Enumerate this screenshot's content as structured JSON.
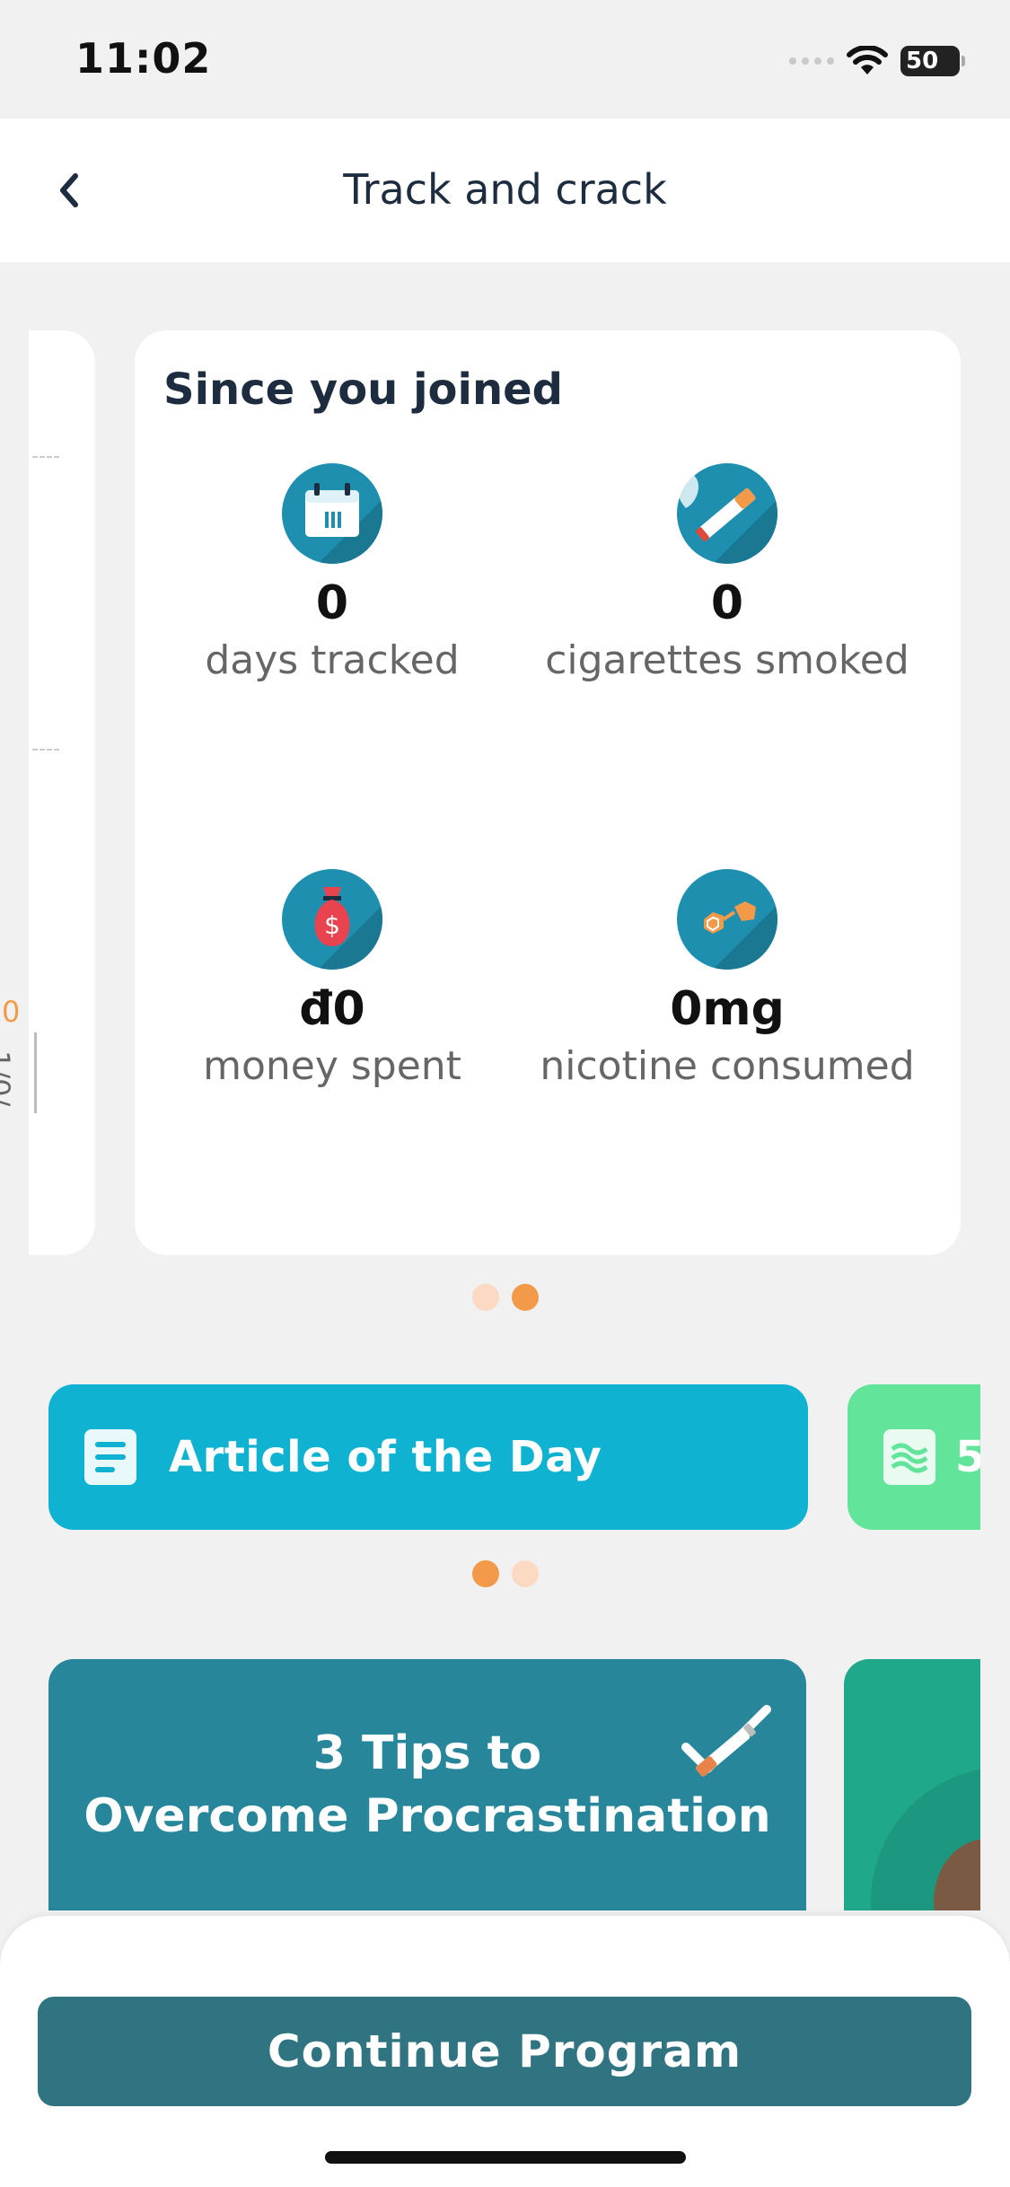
{
  "status_bar": {
    "time": "11:02",
    "battery": "50"
  },
  "header": {
    "title": "Track and crack"
  },
  "prev_card": {
    "value": "0",
    "date_fragment": "1/0/"
  },
  "stats": {
    "title": "Since you joined",
    "items": [
      {
        "icon": "calendar-icon",
        "value": "0",
        "label": "days tracked"
      },
      {
        "icon": "cigarette-icon",
        "value": "0",
        "label": "cigarettes smoked"
      },
      {
        "icon": "money-bag-icon",
        "value": "đ0",
        "label": "money spent"
      },
      {
        "icon": "molecule-icon",
        "value": "0mg",
        "label": "nicotine consumed"
      }
    ],
    "page_count": 2,
    "active_page": 2
  },
  "cards": {
    "article_label": "Article of the Day",
    "next_label_fragment": "5",
    "page_count": 2,
    "active_page": 1
  },
  "tips": {
    "title_line1": "3 Tips to",
    "title_line2": "Overcome Procrastination"
  },
  "cta": {
    "continue_label": "Continue Program"
  },
  "colors": {
    "accent": "#f2994a",
    "teal": "#2f7480",
    "cyan": "#0fb2d1",
    "green": "#63e49b"
  }
}
